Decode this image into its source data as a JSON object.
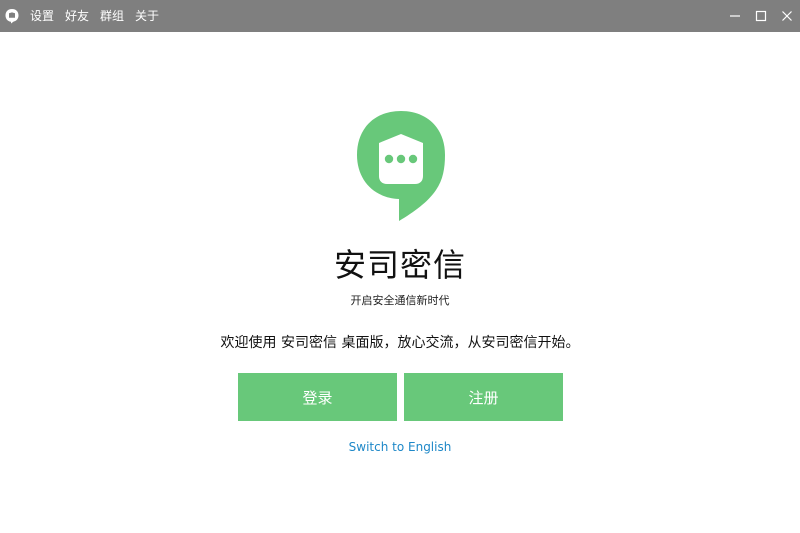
{
  "titlebar": {
    "menu": [
      {
        "label": "设置"
      },
      {
        "label": "好友"
      },
      {
        "label": "群组"
      },
      {
        "label": "关于"
      }
    ]
  },
  "brand": {
    "name": "安司密信",
    "slogan": "开启安全通信新时代",
    "color": "#68c87a"
  },
  "welcome_text": "欢迎使用 安司密信 桌面版，放心交流，从安司密信开始。",
  "buttons": {
    "login": "登录",
    "register": "注册"
  },
  "language_link": "Switch to English",
  "icons": {
    "app": "chat-bubble-icon",
    "minimize": "minimize-icon",
    "maximize": "maximize-icon",
    "close": "close-icon"
  }
}
